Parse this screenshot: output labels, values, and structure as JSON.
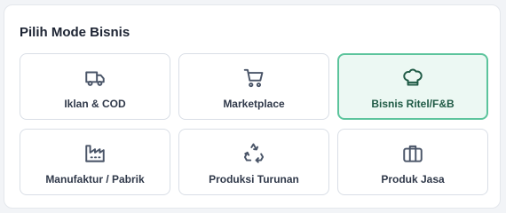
{
  "section": {
    "title": "Pilih Mode Bisnis"
  },
  "modes": [
    {
      "label": "Iklan & COD",
      "icon": "truck-icon",
      "selected": false
    },
    {
      "label": "Marketplace",
      "icon": "shopping-cart-icon",
      "selected": false
    },
    {
      "label": "Bisnis Ritel/F&B",
      "icon": "chef-hat-icon",
      "selected": true
    },
    {
      "label": "Manufaktur / Pabrik",
      "icon": "factory-icon",
      "selected": false
    },
    {
      "label": "Produksi Turunan",
      "icon": "recycle-icon",
      "selected": false
    },
    {
      "label": "Produk Jasa",
      "icon": "briefcase-icon",
      "selected": false
    }
  ],
  "colors": {
    "accent": "#5cc49c",
    "accent_bg": "#ecf8f3",
    "accent_text": "#1f5a45",
    "text": "#30394a",
    "icon": "#4a5568"
  }
}
